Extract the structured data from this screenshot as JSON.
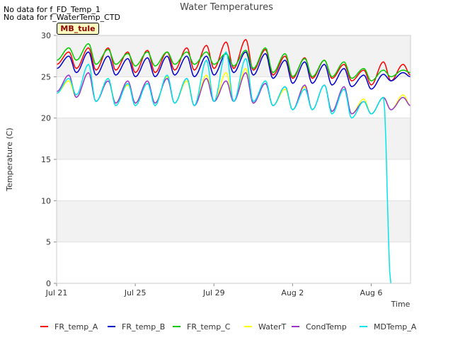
{
  "notes": [
    "No data for f_FD_Temp_1",
    "No data for f_WaterTemp_CTD"
  ],
  "site_tag": "MB_tule",
  "chart_data": {
    "type": "line",
    "title": "Water Temperatures",
    "xlabel": "Time",
    "ylabel": "Temperature (C)",
    "xlim": [
      "2024-07-21",
      "2024-08-08"
    ],
    "ylim": [
      0,
      30
    ],
    "yticks": [
      0,
      5,
      10,
      15,
      20,
      25,
      30
    ],
    "xticks": [
      {
        "date": "2024-07-21",
        "label": "Jul 21"
      },
      {
        "date": "2024-07-25",
        "label": "Jul 25"
      },
      {
        "date": "2024-07-29",
        "label": "Jul 29"
      },
      {
        "date": "2024-08-02",
        "label": "Aug 2"
      },
      {
        "date": "2024-08-06",
        "label": "Aug 6"
      }
    ],
    "grid": "alternating horizontal bands",
    "legend_position": "bottom",
    "series": [
      {
        "name": "FR_temp_A",
        "color": "#ff0000",
        "x": [
          "2024-07-21",
          "2024-07-22",
          "2024-07-23",
          "2024-07-24",
          "2024-07-25",
          "2024-07-26",
          "2024-07-27",
          "2024-07-28",
          "2024-07-29",
          "2024-07-30",
          "2024-07-31",
          "2024-08-01",
          "2024-08-02",
          "2024-08-03",
          "2024-08-04",
          "2024-08-05",
          "2024-08-06",
          "2024-08-07",
          "2024-08-08"
        ],
        "min": [
          26.5,
          26.0,
          25.8,
          25.8,
          25.5,
          25.5,
          25.8,
          25.8,
          26.0,
          26.0,
          25.8,
          25.2,
          24.8,
          24.8,
          24.8,
          24.5,
          24.0,
          24.5,
          25.2
        ],
        "max": [
          28.0,
          28.5,
          28.5,
          28.0,
          28.2,
          28.0,
          28.5,
          28.8,
          29.2,
          29.5,
          28.3,
          27.5,
          27.3,
          27.0,
          26.5,
          25.8,
          26.8,
          26.5,
          27.2
        ]
      },
      {
        "name": "FR_temp_B",
        "color": "#0000cc",
        "x": [
          "2024-07-21",
          "2024-07-22",
          "2024-07-23",
          "2024-07-24",
          "2024-07-25",
          "2024-07-26",
          "2024-07-27",
          "2024-07-28",
          "2024-07-29",
          "2024-07-30",
          "2024-07-31",
          "2024-08-01",
          "2024-08-02",
          "2024-08-03",
          "2024-08-04",
          "2024-08-05",
          "2024-08-06",
          "2024-08-07",
          "2024-08-08"
        ],
        "min": [
          26.0,
          25.5,
          25.2,
          25.2,
          25.0,
          25.0,
          25.2,
          25.0,
          25.2,
          25.5,
          25.2,
          24.8,
          24.2,
          24.2,
          24.0,
          23.8,
          23.5,
          24.5,
          25.0
        ],
        "max": [
          27.5,
          28.0,
          27.5,
          27.2,
          27.3,
          27.5,
          27.5,
          27.5,
          27.8,
          28.0,
          27.8,
          27.0,
          26.8,
          26.5,
          26.0,
          25.2,
          25.3,
          25.5,
          25.5
        ]
      },
      {
        "name": "FR_temp_C",
        "color": "#00cc00",
        "x": [
          "2024-07-21",
          "2024-07-22",
          "2024-07-23",
          "2024-07-24",
          "2024-07-25",
          "2024-07-26",
          "2024-07-27",
          "2024-07-28",
          "2024-07-29",
          "2024-07-30",
          "2024-07-31",
          "2024-08-01",
          "2024-08-02",
          "2024-08-03",
          "2024-08-04",
          "2024-08-05",
          "2024-08-06",
          "2024-08-07",
          "2024-08-08"
        ],
        "min": [
          27.0,
          27.0,
          26.5,
          26.5,
          26.3,
          26.3,
          26.5,
          26.5,
          26.5,
          26.3,
          26.0,
          25.5,
          25.0,
          25.0,
          25.0,
          24.8,
          24.5,
          25.0,
          25.5
        ],
        "max": [
          28.5,
          29.0,
          28.3,
          27.8,
          28.0,
          28.0,
          28.0,
          28.0,
          27.8,
          28.2,
          28.5,
          27.8,
          27.2,
          27.0,
          26.8,
          26.0,
          25.8,
          25.8,
          25.8
        ]
      },
      {
        "name": "WaterT",
        "color": "#ffff00",
        "x": [
          "2024-07-21",
          "2024-07-22",
          "2024-07-23",
          "2024-07-24",
          "2024-07-25",
          "2024-07-26",
          "2024-07-27",
          "2024-07-28",
          "2024-07-29",
          "2024-07-30",
          "2024-07-31",
          "2024-08-01",
          "2024-08-02",
          "2024-08-03",
          "2024-08-04",
          "2024-08-05",
          "2024-08-06",
          "2024-08-07",
          "2024-08-08"
        ],
        "min": [
          23.0,
          22.5,
          22.0,
          21.8,
          21.8,
          21.8,
          21.8,
          21.5,
          22.0,
          22.0,
          21.8,
          21.5,
          21.0,
          21.0,
          20.8,
          20.5,
          20.5,
          21.0,
          21.5
        ],
        "max": [
          24.5,
          25.5,
          24.8,
          24.0,
          24.2,
          25.0,
          24.5,
          25.2,
          25.5,
          26.0,
          24.5,
          23.5,
          23.8,
          24.0,
          23.5,
          22.3,
          22.5,
          22.8,
          23.2
        ]
      },
      {
        "name": "CondTemp",
        "color": "#9933cc",
        "x": [
          "2024-07-21",
          "2024-07-22",
          "2024-07-23",
          "2024-07-24",
          "2024-07-25",
          "2024-07-26",
          "2024-07-27",
          "2024-07-28",
          "2024-07-29",
          "2024-07-30",
          "2024-07-31",
          "2024-08-01",
          "2024-08-02",
          "2024-08-03",
          "2024-08-04",
          "2024-08-05",
          "2024-08-06",
          "2024-08-07",
          "2024-08-08"
        ],
        "min": [
          23.2,
          22.5,
          22.0,
          21.8,
          21.8,
          21.8,
          21.8,
          21.5,
          22.0,
          22.0,
          21.8,
          21.5,
          21.0,
          21.0,
          20.8,
          20.5,
          20.5,
          21.0,
          21.5
        ],
        "max": [
          25.2,
          25.5,
          24.5,
          24.5,
          24.5,
          24.8,
          24.8,
          24.8,
          24.5,
          25.5,
          24.2,
          23.8,
          24.0,
          24.0,
          23.8,
          22.0,
          22.5,
          22.5,
          22.3
        ]
      },
      {
        "name": "MDTemp_A",
        "color": "#00e5ee",
        "x": [
          "2024-07-21",
          "2024-07-22",
          "2024-07-23",
          "2024-07-24",
          "2024-07-25",
          "2024-07-26",
          "2024-07-27",
          "2024-07-28",
          "2024-07-29",
          "2024-07-30",
          "2024-07-31",
          "2024-08-01",
          "2024-08-02",
          "2024-08-03",
          "2024-08-04",
          "2024-08-05",
          "2024-08-06",
          "2024-08-07"
        ],
        "min": [
          23.0,
          22.8,
          22.0,
          21.5,
          21.5,
          21.5,
          21.8,
          21.5,
          22.0,
          22.0,
          22.0,
          21.5,
          21.0,
          21.0,
          20.5,
          20.0,
          20.5,
          0.0
        ],
        "max": [
          24.8,
          26.5,
          24.8,
          24.2,
          24.2,
          25.2,
          24.8,
          27.0,
          28.0,
          27.2,
          24.5,
          23.8,
          23.5,
          24.0,
          23.5,
          22.0,
          22.5,
          21.0
        ]
      }
    ]
  }
}
